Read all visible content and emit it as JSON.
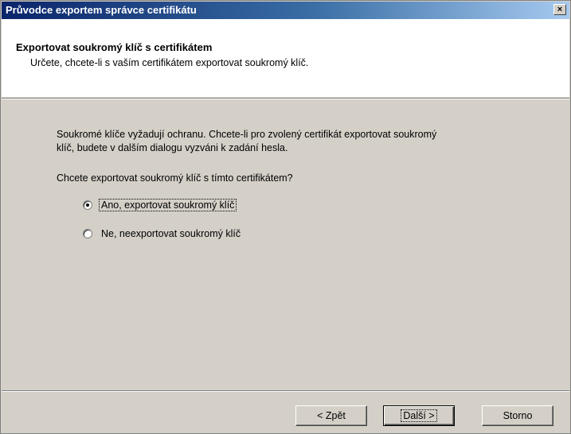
{
  "window": {
    "title": "Průvodce exportem správce certifikátu",
    "close_glyph": "×"
  },
  "header": {
    "title": "Exportovat soukromý klíč s certifikátem",
    "subtitle": "Určete, chcete-li s vaším certifikátem exportovat soukromý klíč."
  },
  "main": {
    "description_line1": "Soukromé klíče vyžadují ochranu. Chcete-li pro zvolený certifikát exportovat soukromý",
    "description_line2": "klíč, budete v dalším dialogu vyzváni k zadání hesla.",
    "question": "Chcete exportovat soukromý klíč s tímto certifikátem?",
    "options": [
      {
        "label": "Ano, exportovat soukromý klíč",
        "selected": true
      },
      {
        "label": "Ne, neexportovat soukromý klíč",
        "selected": false
      }
    ]
  },
  "buttons": {
    "back": "< Zpět",
    "next": "Další >",
    "cancel": "Storno"
  }
}
